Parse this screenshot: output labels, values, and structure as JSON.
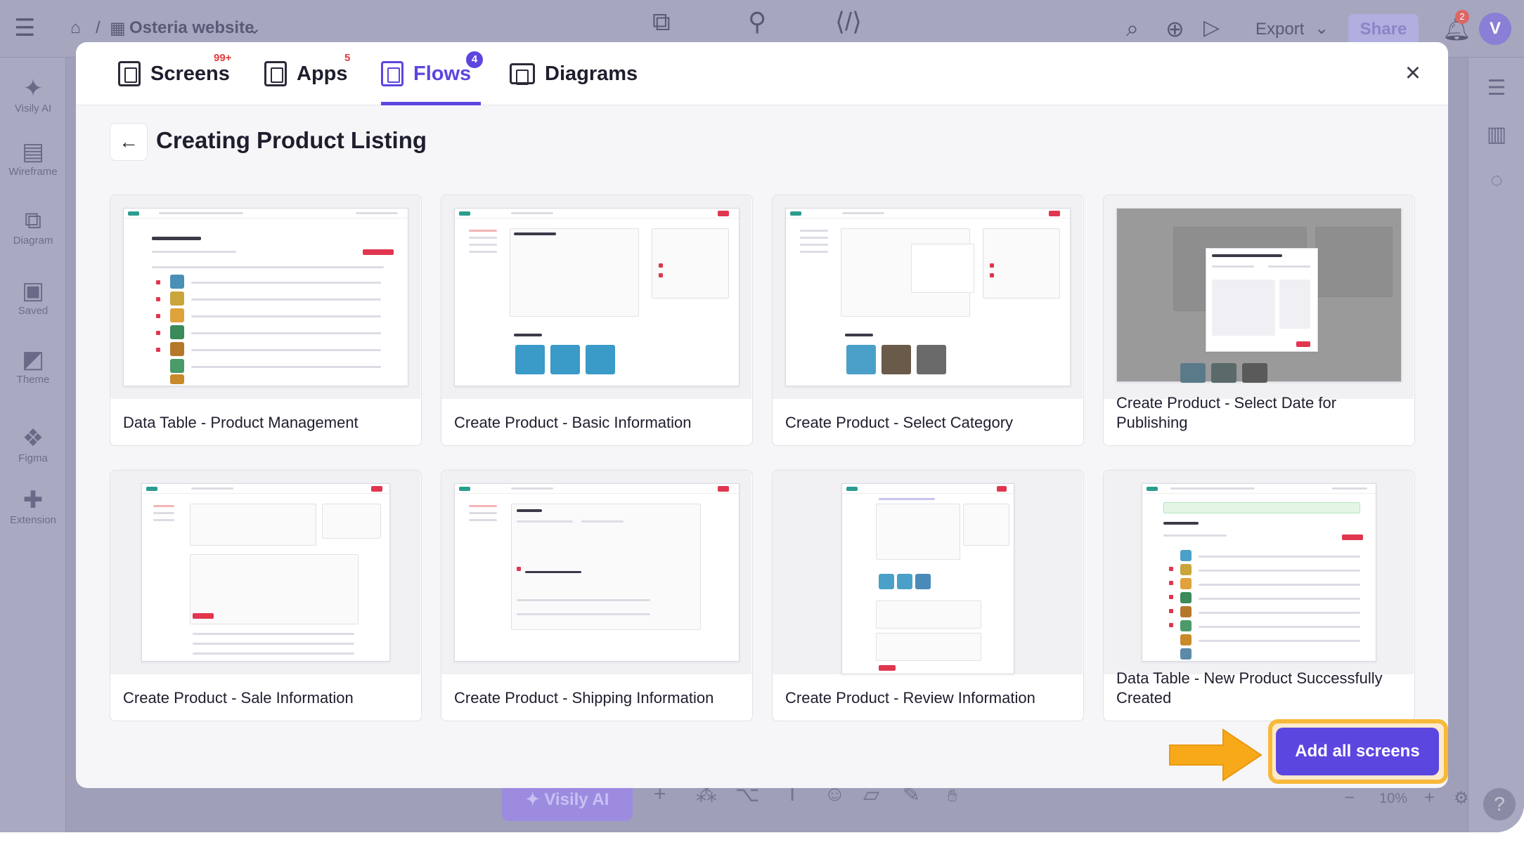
{
  "app": {
    "breadcrumb_project": "Osteria website",
    "export_label": "Export",
    "share_label": "Share",
    "notification_count": "2",
    "avatar_letter": "V",
    "sidebar": [
      "Visily AI",
      "Wireframe",
      "Diagram",
      "Saved",
      "Theme",
      "Figma",
      "Extension"
    ],
    "bottom": {
      "visily_ai": "Visily AI",
      "zoom": "10%"
    }
  },
  "modal": {
    "tabs": [
      {
        "label": "Screens",
        "badge": "99+"
      },
      {
        "label": "Apps",
        "badge": "5"
      },
      {
        "label": "Flows",
        "badge": "4"
      },
      {
        "label": "Diagrams",
        "badge": ""
      }
    ],
    "active_tab": "Flows",
    "title": "Creating Product Listing",
    "screens": [
      {
        "label": "Data Table - Product Management"
      },
      {
        "label": "Create Product - Basic Information"
      },
      {
        "label": "Create Product - Select Category"
      },
      {
        "label": "Create Product - Select Date for Publishing"
      },
      {
        "label": "Create Product - Sale Information"
      },
      {
        "label": "Create Product - Shipping Information"
      },
      {
        "label": "Create Product - Review Information"
      },
      {
        "label": "Data Table - New Product Successfully Created"
      }
    ],
    "add_all_label": "Add all screens"
  },
  "colors": {
    "accent": "#5b46e0",
    "highlight": "#f7b93a",
    "danger": "#e0364f"
  }
}
